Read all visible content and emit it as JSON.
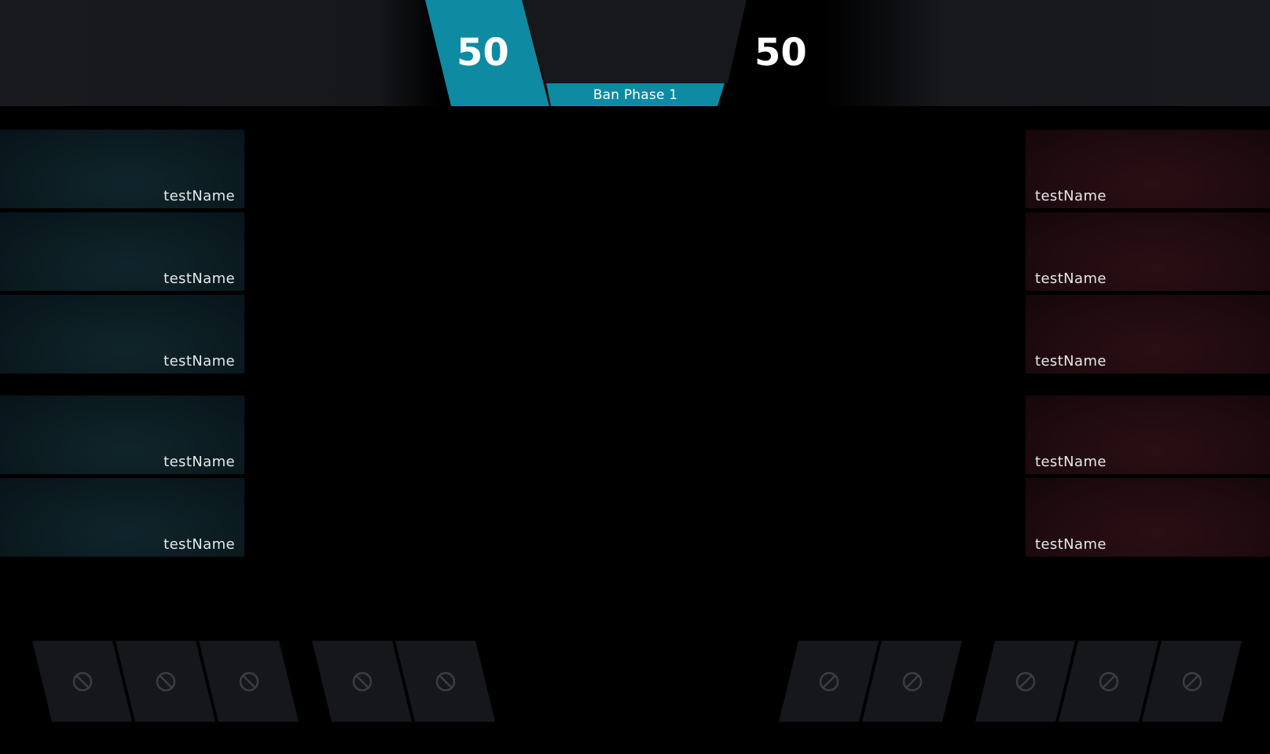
{
  "scoreboard": {
    "left_score": "50",
    "right_score": "50",
    "phase_label": "Ban Phase 1"
  },
  "colors": {
    "accent_blue": "#0e8aa3",
    "team_left": "#0b1c21",
    "team_right": "#200b10",
    "ban_slot": "#15171b"
  },
  "team_left": {
    "players": [
      {
        "name": "testName"
      },
      {
        "name": "testName"
      },
      {
        "name": "testName"
      },
      {
        "name": "testName"
      },
      {
        "name": "testName"
      }
    ],
    "bans": [
      {
        "icon": "ban-icon"
      },
      {
        "icon": "ban-icon"
      },
      {
        "icon": "ban-icon"
      },
      {
        "icon": "ban-icon"
      },
      {
        "icon": "ban-icon"
      }
    ]
  },
  "team_right": {
    "players": [
      {
        "name": "testName"
      },
      {
        "name": "testName"
      },
      {
        "name": "testName"
      },
      {
        "name": "testName"
      },
      {
        "name": "testName"
      }
    ],
    "bans": [
      {
        "icon": "ban-icon"
      },
      {
        "icon": "ban-icon"
      },
      {
        "icon": "ban-icon"
      },
      {
        "icon": "ban-icon"
      },
      {
        "icon": "ban-icon"
      }
    ]
  }
}
